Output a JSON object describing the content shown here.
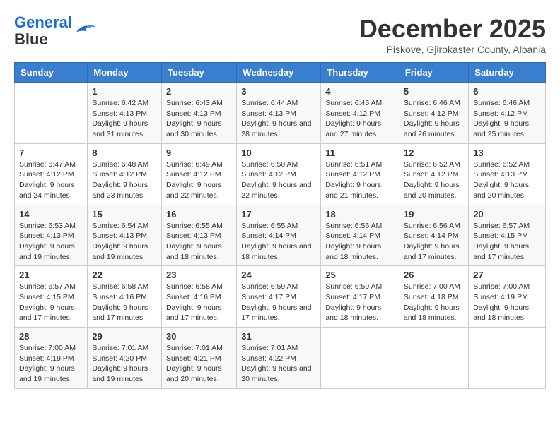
{
  "logo": {
    "line1": "General",
    "line2": "Blue"
  },
  "title": "December 2025",
  "location": "Piskove, Gjirokaster County, Albania",
  "days_of_week": [
    "Sunday",
    "Monday",
    "Tuesday",
    "Wednesday",
    "Thursday",
    "Friday",
    "Saturday"
  ],
  "weeks": [
    [
      {
        "day": "",
        "sunrise": "",
        "sunset": "",
        "daylight": ""
      },
      {
        "day": "1",
        "sunrise": "Sunrise: 6:42 AM",
        "sunset": "Sunset: 4:13 PM",
        "daylight": "Daylight: 9 hours and 31 minutes."
      },
      {
        "day": "2",
        "sunrise": "Sunrise: 6:43 AM",
        "sunset": "Sunset: 4:13 PM",
        "daylight": "Daylight: 9 hours and 30 minutes."
      },
      {
        "day": "3",
        "sunrise": "Sunrise: 6:44 AM",
        "sunset": "Sunset: 4:13 PM",
        "daylight": "Daylight: 9 hours and 28 minutes."
      },
      {
        "day": "4",
        "sunrise": "Sunrise: 6:45 AM",
        "sunset": "Sunset: 4:12 PM",
        "daylight": "Daylight: 9 hours and 27 minutes."
      },
      {
        "day": "5",
        "sunrise": "Sunrise: 6:46 AM",
        "sunset": "Sunset: 4:12 PM",
        "daylight": "Daylight: 9 hours and 26 minutes."
      },
      {
        "day": "6",
        "sunrise": "Sunrise: 6:46 AM",
        "sunset": "Sunset: 4:12 PM",
        "daylight": "Daylight: 9 hours and 25 minutes."
      }
    ],
    [
      {
        "day": "7",
        "sunrise": "Sunrise: 6:47 AM",
        "sunset": "Sunset: 4:12 PM",
        "daylight": "Daylight: 9 hours and 24 minutes."
      },
      {
        "day": "8",
        "sunrise": "Sunrise: 6:48 AM",
        "sunset": "Sunset: 4:12 PM",
        "daylight": "Daylight: 9 hours and 23 minutes."
      },
      {
        "day": "9",
        "sunrise": "Sunrise: 6:49 AM",
        "sunset": "Sunset: 4:12 PM",
        "daylight": "Daylight: 9 hours and 22 minutes."
      },
      {
        "day": "10",
        "sunrise": "Sunrise: 6:50 AM",
        "sunset": "Sunset: 4:12 PM",
        "daylight": "Daylight: 9 hours and 22 minutes."
      },
      {
        "day": "11",
        "sunrise": "Sunrise: 6:51 AM",
        "sunset": "Sunset: 4:12 PM",
        "daylight": "Daylight: 9 hours and 21 minutes."
      },
      {
        "day": "12",
        "sunrise": "Sunrise: 6:52 AM",
        "sunset": "Sunset: 4:12 PM",
        "daylight": "Daylight: 9 hours and 20 minutes."
      },
      {
        "day": "13",
        "sunrise": "Sunrise: 6:52 AM",
        "sunset": "Sunset: 4:13 PM",
        "daylight": "Daylight: 9 hours and 20 minutes."
      }
    ],
    [
      {
        "day": "14",
        "sunrise": "Sunrise: 6:53 AM",
        "sunset": "Sunset: 4:13 PM",
        "daylight": "Daylight: 9 hours and 19 minutes."
      },
      {
        "day": "15",
        "sunrise": "Sunrise: 6:54 AM",
        "sunset": "Sunset: 4:13 PM",
        "daylight": "Daylight: 9 hours and 19 minutes."
      },
      {
        "day": "16",
        "sunrise": "Sunrise: 6:55 AM",
        "sunset": "Sunset: 4:13 PM",
        "daylight": "Daylight: 9 hours and 18 minutes."
      },
      {
        "day": "17",
        "sunrise": "Sunrise: 6:55 AM",
        "sunset": "Sunset: 4:14 PM",
        "daylight": "Daylight: 9 hours and 18 minutes."
      },
      {
        "day": "18",
        "sunrise": "Sunrise: 6:56 AM",
        "sunset": "Sunset: 4:14 PM",
        "daylight": "Daylight: 9 hours and 18 minutes."
      },
      {
        "day": "19",
        "sunrise": "Sunrise: 6:56 AM",
        "sunset": "Sunset: 4:14 PM",
        "daylight": "Daylight: 9 hours and 17 minutes."
      },
      {
        "day": "20",
        "sunrise": "Sunrise: 6:57 AM",
        "sunset": "Sunset: 4:15 PM",
        "daylight": "Daylight: 9 hours and 17 minutes."
      }
    ],
    [
      {
        "day": "21",
        "sunrise": "Sunrise: 6:57 AM",
        "sunset": "Sunset: 4:15 PM",
        "daylight": "Daylight: 9 hours and 17 minutes."
      },
      {
        "day": "22",
        "sunrise": "Sunrise: 6:58 AM",
        "sunset": "Sunset: 4:16 PM",
        "daylight": "Daylight: 9 hours and 17 minutes."
      },
      {
        "day": "23",
        "sunrise": "Sunrise: 6:58 AM",
        "sunset": "Sunset: 4:16 PM",
        "daylight": "Daylight: 9 hours and 17 minutes."
      },
      {
        "day": "24",
        "sunrise": "Sunrise: 6:59 AM",
        "sunset": "Sunset: 4:17 PM",
        "daylight": "Daylight: 9 hours and 17 minutes."
      },
      {
        "day": "25",
        "sunrise": "Sunrise: 6:59 AM",
        "sunset": "Sunset: 4:17 PM",
        "daylight": "Daylight: 9 hours and 18 minutes."
      },
      {
        "day": "26",
        "sunrise": "Sunrise: 7:00 AM",
        "sunset": "Sunset: 4:18 PM",
        "daylight": "Daylight: 9 hours and 18 minutes."
      },
      {
        "day": "27",
        "sunrise": "Sunrise: 7:00 AM",
        "sunset": "Sunset: 4:19 PM",
        "daylight": "Daylight: 9 hours and 18 minutes."
      }
    ],
    [
      {
        "day": "28",
        "sunrise": "Sunrise: 7:00 AM",
        "sunset": "Sunset: 4:19 PM",
        "daylight": "Daylight: 9 hours and 19 minutes."
      },
      {
        "day": "29",
        "sunrise": "Sunrise: 7:01 AM",
        "sunset": "Sunset: 4:20 PM",
        "daylight": "Daylight: 9 hours and 19 minutes."
      },
      {
        "day": "30",
        "sunrise": "Sunrise: 7:01 AM",
        "sunset": "Sunset: 4:21 PM",
        "daylight": "Daylight: 9 hours and 20 minutes."
      },
      {
        "day": "31",
        "sunrise": "Sunrise: 7:01 AM",
        "sunset": "Sunset: 4:22 PM",
        "daylight": "Daylight: 9 hours and 20 minutes."
      },
      {
        "day": "",
        "sunrise": "",
        "sunset": "",
        "daylight": ""
      },
      {
        "day": "",
        "sunrise": "",
        "sunset": "",
        "daylight": ""
      },
      {
        "day": "",
        "sunrise": "",
        "sunset": "",
        "daylight": ""
      }
    ]
  ]
}
